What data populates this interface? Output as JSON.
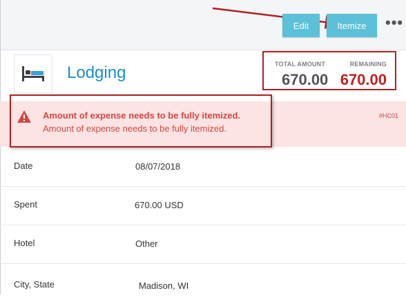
{
  "toolbar": {
    "edit_label": "Edit",
    "itemize_label": "Itemize",
    "more_label": "•••"
  },
  "header": {
    "icon": "bed-icon",
    "title": "Lodging"
  },
  "amounts": {
    "total_label": "TOTAL AMOUNT",
    "total_value": "670.00",
    "remaining_label": "REMAINING",
    "remaining_value": "670.00"
  },
  "alert": {
    "title": "Amount of expense needs to be fully itemized.",
    "message": "Amount of expense needs to be fully itemized.",
    "code": "#HC01"
  },
  "fields": [
    {
      "label": "Date",
      "value": "08/07/2018"
    },
    {
      "label": "Spent",
      "value": "670.00 USD"
    },
    {
      "label": "Hotel",
      "value": "Other"
    },
    {
      "label": "City, State",
      "value": "Madison, WI"
    }
  ],
  "colors": {
    "accent": "#5bc0d8",
    "title_blue": "#1a8fc9",
    "alert_red": "#d64541",
    "annotation_red": "#b01e1e"
  }
}
